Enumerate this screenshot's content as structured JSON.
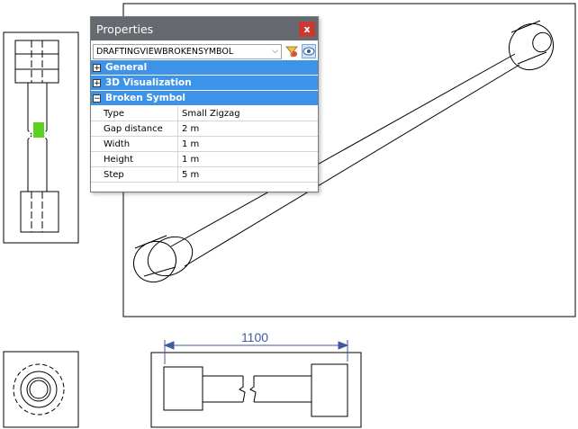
{
  "dimension": {
    "label": "1100"
  },
  "properties_panel": {
    "title": "Properties",
    "close_label": "x",
    "entity_selector": "DRAFTINGVIEWBROKENSYMBOL",
    "groups": [
      {
        "label": "General",
        "expander": "+"
      },
      {
        "label": "3D Visualization",
        "expander": "+"
      },
      {
        "label": "Broken Symbol",
        "expander": "−"
      }
    ],
    "rows": [
      {
        "name": "Type",
        "value": "Small Zigzag"
      },
      {
        "name": "Gap distance",
        "value": "2 m"
      },
      {
        "name": "Width",
        "value": "1 m"
      },
      {
        "name": "Height",
        "value": "1 m"
      },
      {
        "name": "Step",
        "value": "5 m"
      }
    ]
  },
  "colors": {
    "drawing_line": "#000000",
    "dimension": "#3f5aa0",
    "grip": "#5ad21e",
    "group_header": "#3d93e8",
    "title_bar": "#666a70",
    "close_button": "#c8392f"
  }
}
